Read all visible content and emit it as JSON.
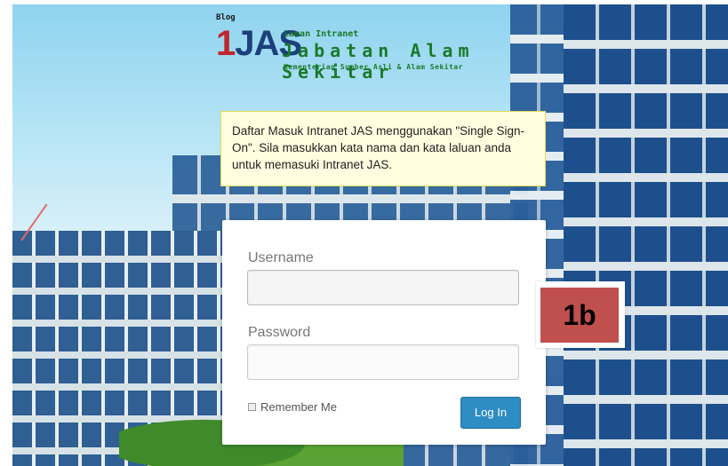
{
  "logo": {
    "blog": "Blog",
    "one": "1",
    "jas": "JAS",
    "line_small": "Laman Intranet",
    "line_big": "Jabatan Alam Sekitar",
    "line_sub": "Kementerian Sumber Asli & Alam Sekitar"
  },
  "notice": {
    "text": "Daftar Masuk Intranet JAS menggunakan \"Single Sign-On\". Sila masukkan kata nama dan kata laluan anda untuk memasuki Intranet JAS."
  },
  "login": {
    "username_label": "Username",
    "username_value": "",
    "password_label": "Password",
    "password_value": "",
    "remember_label": "Remember Me",
    "remember_checked": false,
    "submit_label": "Log In",
    "button_color": "#2e8dc2"
  },
  "annotation": {
    "label": "1b",
    "color": "#c0504d"
  }
}
